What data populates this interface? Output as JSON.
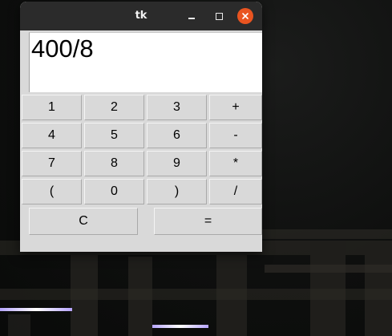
{
  "window": {
    "title": "tk"
  },
  "display": {
    "value": "400/8"
  },
  "keypad": [
    [
      "1",
      "2",
      "3",
      "+"
    ],
    [
      "4",
      "5",
      "6",
      "-"
    ],
    [
      "7",
      "8",
      "9",
      "*"
    ],
    [
      "(",
      "0",
      ")",
      "/"
    ]
  ],
  "actions": {
    "clear": "C",
    "equals": "="
  },
  "colors": {
    "titlebar": "#2b2b2b",
    "close_button": "#e95420",
    "window_bg": "#d9d9d9"
  },
  "icons": [
    "minimize-icon",
    "maximize-icon",
    "close-icon"
  ]
}
